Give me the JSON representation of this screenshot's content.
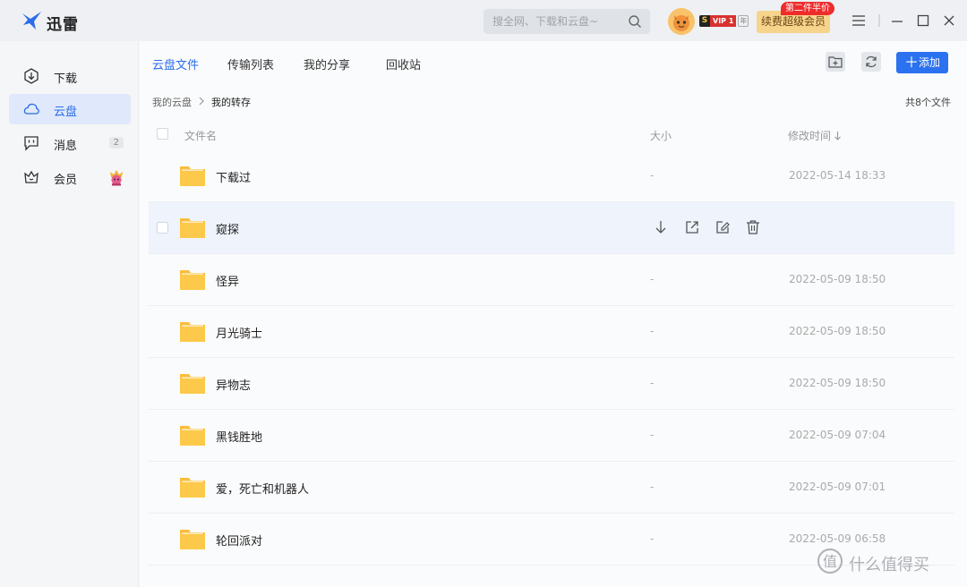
{
  "app": {
    "name": "迅雷"
  },
  "search": {
    "placeholder": "搜全网、下载和云盘~"
  },
  "account": {
    "vip_label": "VIP 1",
    "vip_year": "年",
    "vip_prefix": "S",
    "renew_label": "续费超级会员",
    "promo_label": "第二件半价"
  },
  "sidebar": {
    "items": [
      {
        "label": "下载",
        "icon": "download-icon"
      },
      {
        "label": "云盘",
        "icon": "cloud-icon",
        "active": true
      },
      {
        "label": "消息",
        "icon": "message-icon",
        "count": "2"
      },
      {
        "label": "会员",
        "icon": "crown-icon"
      }
    ]
  },
  "tabs": [
    {
      "label": "云盘文件",
      "active": true
    },
    {
      "label": "传输列表"
    },
    {
      "label": "我的分享"
    },
    {
      "label": "回收站"
    }
  ],
  "toolbar": {
    "add_label": "添加"
  },
  "breadcrumb": {
    "root": "我的云盘",
    "current": "我的转存"
  },
  "file_count": "共8个文件",
  "columns": {
    "name": "文件名",
    "size": "大小",
    "modified": "修改时间"
  },
  "files": [
    {
      "name": "下载过",
      "size": "-",
      "modified": "2022-05-14 18:33"
    },
    {
      "name": "窥探",
      "size": "",
      "modified": "",
      "hovered": true
    },
    {
      "name": "怪异",
      "size": "-",
      "modified": "2022-05-09 18:50"
    },
    {
      "name": "月光骑士",
      "size": "-",
      "modified": "2022-05-09 18:50"
    },
    {
      "name": "异物志",
      "size": "-",
      "modified": "2022-05-09 18:50"
    },
    {
      "name": "黑钱胜地",
      "size": "-",
      "modified": "2022-05-09 07:04"
    },
    {
      "name": "爱，死亡和机器人",
      "size": "-",
      "modified": "2022-05-09 07:01"
    },
    {
      "name": "轮回派对",
      "size": "-",
      "modified": "2022-05-09 06:58"
    }
  ],
  "watermark": "什么值得买",
  "colors": {
    "accent": "#2b72f0",
    "folder": "#fbbd3c",
    "hover_row": "#eef3fc"
  }
}
